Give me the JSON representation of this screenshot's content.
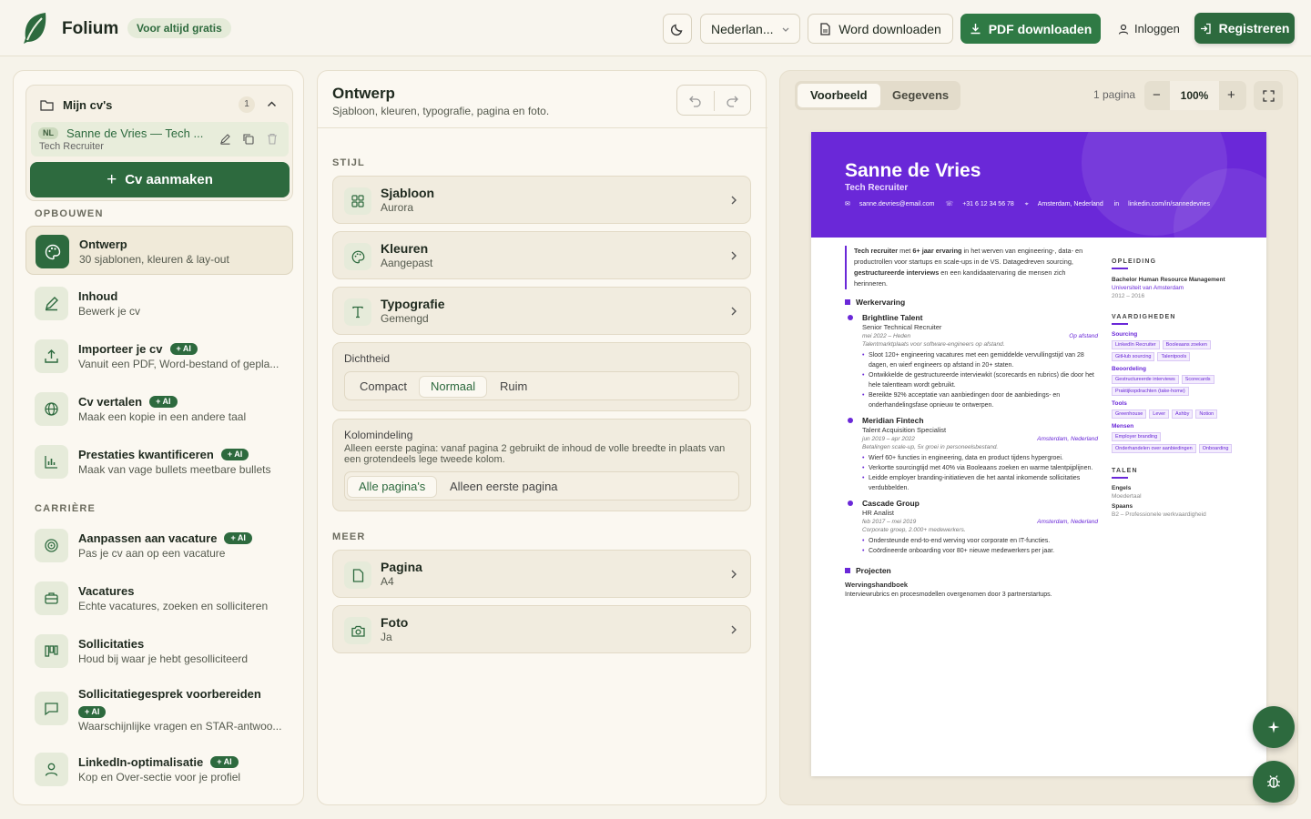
{
  "header": {
    "brand": "Folium",
    "badge": "Voor altijd gratis",
    "language": "Nederlan...",
    "word_btn": "Word downloaden",
    "pdf_btn": "PDF downloaden",
    "login": "Inloggen",
    "register": "Registreren"
  },
  "sidebar": {
    "mycv_title": "Mijn cv's",
    "mycv_count": "1",
    "cv": {
      "lang": "NL",
      "name": "Sanne de Vries — Tech ...",
      "role": "Tech Recruiter"
    },
    "new_cv": "Cv aanmaken",
    "section_build": "OPBOUWEN",
    "section_career": "CARRIÈRE",
    "ai_badge": "+ AI",
    "items": [
      {
        "title": "Ontwerp",
        "desc": "30 sjablonen, kleuren & lay-out",
        "icon": "palette-icon"
      },
      {
        "title": "Inhoud",
        "desc": "Bewerk je cv",
        "icon": "pencil-icon"
      },
      {
        "title": "Importeer je cv",
        "desc": "Vanuit een PDF, Word-bestand of gepla...",
        "icon": "upload-icon"
      },
      {
        "title": "Cv vertalen",
        "desc": "Maak een kopie in een andere taal",
        "icon": "globe-icon"
      },
      {
        "title": "Prestaties kwantificeren",
        "desc": "Maak van vage bullets meetbare bullets",
        "icon": "bar-chart-icon"
      },
      {
        "title": "Aanpassen aan vacature",
        "desc": "Pas je cv aan op een vacature",
        "icon": "target-icon"
      },
      {
        "title": "Vacatures",
        "desc": "Echte vacatures, zoeken en solliciteren",
        "icon": "briefcase-icon"
      },
      {
        "title": "Sollicitaties",
        "desc": "Houd bij waar je hebt gesolliciteerd",
        "icon": "kanban-icon"
      },
      {
        "title": "Sollicitatiegesprek voorbereiden",
        "desc": "Waarschijnlijke vragen en STAR-antwoo...",
        "icon": "chat-icon"
      },
      {
        "title": "LinkedIn-optimalisatie",
        "desc": "Kop en Over-sectie voor je profiel",
        "icon": "user-icon"
      }
    ]
  },
  "design": {
    "title": "Ontwerp",
    "subtitle": "Sjabloon, kleuren, typografie, pagina en foto.",
    "style_label": "STIJL",
    "more_label": "MEER",
    "template": {
      "title": "Sjabloon",
      "value": "Aurora"
    },
    "colors": {
      "title": "Kleuren",
      "value": "Aangepast"
    },
    "typography": {
      "title": "Typografie",
      "value": "Gemengd"
    },
    "density": {
      "label": "Dichtheid",
      "options": [
        "Compact",
        "Normaal",
        "Ruim"
      ]
    },
    "columns": {
      "label": "Kolomindeling",
      "help": "Alleen eerste pagina: vanaf pagina 2 gebruikt de inhoud de volle breedte in plaats van een grotendeels lege tweede kolom.",
      "options": [
        "Alle pagina's",
        "Alleen eerste pagina"
      ]
    },
    "page": {
      "title": "Pagina",
      "value": "A4"
    },
    "photo": {
      "title": "Foto",
      "value": "Ja"
    }
  },
  "preview": {
    "tab_preview": "Voorbeeld",
    "tab_data": "Gegevens",
    "pages": "1 pagina",
    "zoom": "100%",
    "minus": "−",
    "plus": "+"
  },
  "resume": {
    "name": "Sanne de Vries",
    "title": "Tech Recruiter",
    "email": "sanne.devries@email.com",
    "phone": "+31 6 12 34 56 78",
    "location": "Amsterdam, Nederland",
    "linkedin": "linkedin.com/in/sannedevries",
    "summary_a": "Tech recruiter",
    "summary_b": " met ",
    "summary_c": "6+ jaar ervaring",
    "summary_d": " in het werven van engineering-, data- en productrollen voor startups en scale-ups in de VS. Datagedreven sourcing, ",
    "summary_e": "gestructureerde interviews",
    "summary_f": " en een kandidaatervaring die mensen zich herinneren.",
    "sec_work": "Werkervaring",
    "sec_projects": "Projecten",
    "jobs": [
      {
        "company": "Brightline Talent",
        "role": "Senior Technical Recruiter",
        "dates": "mei 2022 – Heden",
        "loc": "Op afstand",
        "note": "Talentmarktplaats voor software-engineers op afstand.",
        "bullets": [
          "Sloot 120+ engineering vacatures met een gemiddelde vervullingstijd van 28 dagen, en wierf engineers op afstand in 20+ staten.",
          "Ontwikkelde de gestructureerde interviewkit (scorecards en rubrics) die door het hele talentteam wordt gebruikt.",
          "Bereikte 92% acceptatie van aanbiedingen door de aanbiedings- en onderhandelingsfase opnieuw te ontwerpen."
        ]
      },
      {
        "company": "Meridian Fintech",
        "role": "Talent Acquisition Specialist",
        "dates": "jun 2019 – apr 2022",
        "loc": "Amsterdam, Nederland",
        "note": "Betalingen scale-up, 5x groei in personeelsbestand.",
        "bullets": [
          "Wierf 60+ functies in engineering, data en product tijdens hypergroei.",
          "Verkortte sourcingtijd met 40% via Booleaans zoeken en warme talentpijplijnen.",
          "Leidde employer branding-initiatieven die het aantal inkomende sollicitaties verdubbelden."
        ]
      },
      {
        "company": "Cascade Group",
        "role": "HR Analist",
        "dates": "feb 2017 – mei 2019",
        "loc": "Amsterdam, Nederland",
        "note": "Corporate groep, 2.000+ medewerkers.",
        "bullets": [
          "Ondersteunde end-to-end werving voor corporate en IT-functies.",
          "Coördineerde onboarding voor 80+ nieuwe medewerkers per jaar."
        ]
      }
    ],
    "project_name": "Wervingshandboek",
    "project_desc": "Interviewrubrics en procesmodellen overgenomen door 3 partnerstartups.",
    "edu_label": "OPLEIDING",
    "edu_degree": "Bachelor Human Resource Management",
    "edu_school": "Universiteit van Amsterdam",
    "edu_years": "2012 – 2016",
    "skills_label": "VAARDIGHEDEN",
    "skills": [
      {
        "group": "Sourcing",
        "tags": [
          "LinkedIn Recruiter",
          "Booleaans zoeken",
          "GitHub sourcing",
          "Talentpools"
        ]
      },
      {
        "group": "Beoordeling",
        "tags": [
          "Gestructureerde interviews",
          "Scorecards",
          "Praktijkopdrachten (take-home)"
        ]
      },
      {
        "group": "Tools",
        "tags": [
          "Greenhouse",
          "Lever",
          "Ashby",
          "Notion"
        ]
      },
      {
        "group": "Mensen",
        "tags": [
          "Employer branding",
          "Onderhandelen over aanbiedingen",
          "Onboarding"
        ]
      }
    ],
    "lang_label": "TALEN",
    "lang1": "Engels",
    "lang1_level": "Moedertaal",
    "lang2": "Spaans",
    "lang2_level": "B2 – Professionele werkvaardigheid"
  },
  "colors": {
    "accent": "#2d6a3e",
    "resume_accent": "#6a28d8"
  }
}
